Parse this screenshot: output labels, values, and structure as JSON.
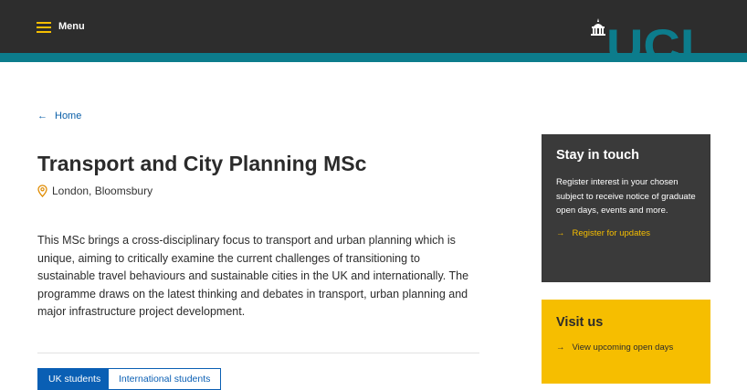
{
  "header": {
    "menu_label": "Menu",
    "logo_text": "UCL",
    "colors": {
      "bar": "#2d2d2d",
      "strip": "#0c7c8c",
      "accent": "#f6be00"
    }
  },
  "breadcrumb": {
    "label": "Home",
    "icon": "arrow-left-icon"
  },
  "main": {
    "title": "Transport and City Planning MSc",
    "location": "London, Bloomsbury",
    "intro": "This MSc brings a cross-disciplinary focus to transport and urban planning which is unique, aiming to critically examine the current challenges of transitioning to sustainable travel behaviours and sustainable cities in the UK and internationally. The programme draws on the latest thinking and debates in transport, urban planning and major infrastructure project development."
  },
  "tabs": [
    {
      "label": "UK students",
      "selected": true
    },
    {
      "label": "International students",
      "selected": false
    }
  ],
  "stay_in_touch": {
    "heading": "Stay in touch",
    "body": "Register interest in your chosen subject to receive notice of graduate open days, events and more.",
    "link": "Register for updates"
  },
  "visit_us": {
    "heading": "Visit us",
    "link": "View upcoming open days"
  }
}
